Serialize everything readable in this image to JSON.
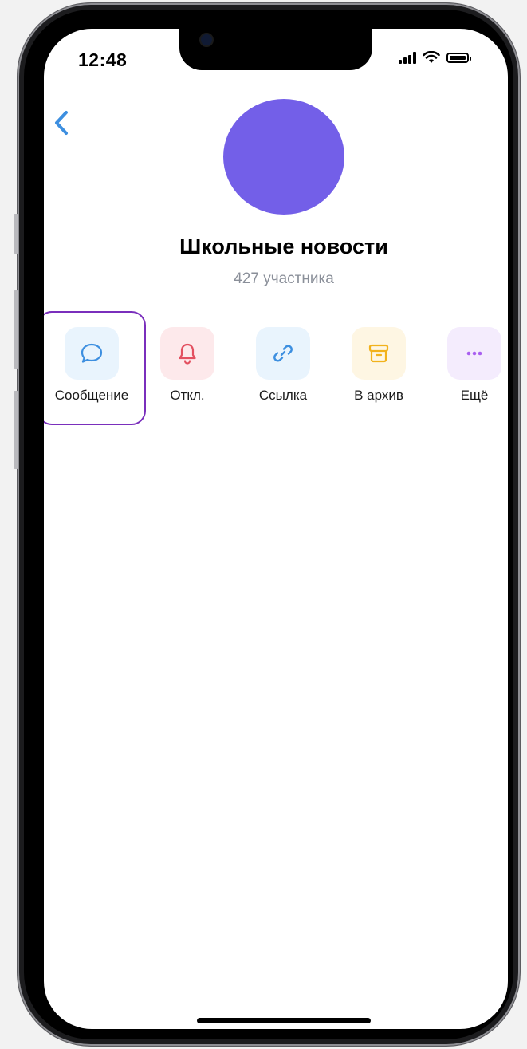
{
  "status_bar": {
    "time": "12:48",
    "icons": [
      "cellular-signal-icon",
      "wifi-icon",
      "battery-icon"
    ]
  },
  "nav": {
    "back_icon": "chevron-left-icon"
  },
  "profile": {
    "avatar_color": "#735fe8",
    "name": "Школьные новости",
    "members": "427 участника"
  },
  "actions": [
    {
      "label": "Сообщение",
      "icon": "message-bubble-icon",
      "color": "#3d8fe0",
      "bg": "#e9f4fd",
      "highlighted": true
    },
    {
      "label": "Откл.",
      "icon": "bell-icon",
      "color": "#e35060",
      "bg": "#fde9eb"
    },
    {
      "label": "Ссылка",
      "icon": "link-icon",
      "color": "#3d8fe0",
      "bg": "#e9f4fd"
    },
    {
      "label": "В архив",
      "icon": "archive-box-icon",
      "color": "#f2b21c",
      "bg": "#fef6e3"
    },
    {
      "label": "Ещё",
      "icon": "more-dots-icon",
      "color": "#a95ff0",
      "bg": "#f4ecfd"
    }
  ],
  "colors": {
    "highlight_border": "#7a2fbc",
    "accent_blue": "#3d8fe0"
  }
}
